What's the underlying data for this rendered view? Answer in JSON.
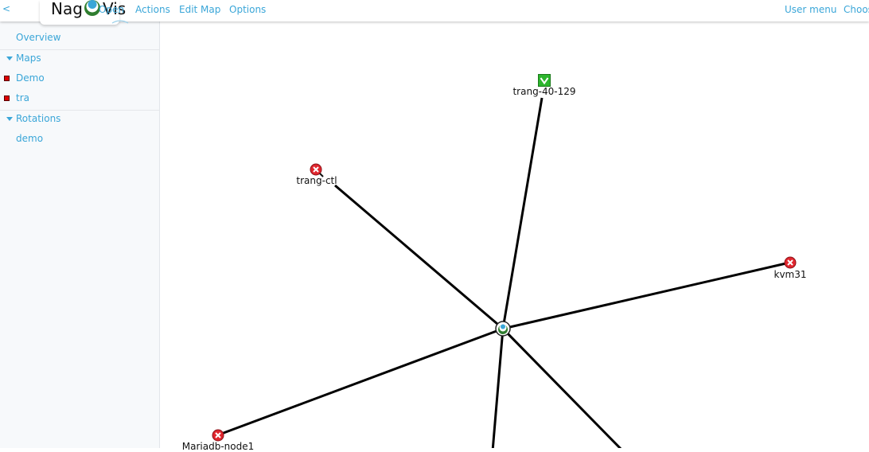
{
  "header": {
    "back": "<",
    "logo": {
      "part1": "Nag",
      "part2": "Vis"
    },
    "menu": [
      "Open",
      "Actions",
      "Edit Map",
      "Options"
    ],
    "user_menu": "User menu",
    "choose": "Choos"
  },
  "sidebar": {
    "overview": "Overview",
    "maps_header": "Maps",
    "maps": [
      "Demo",
      "tra"
    ],
    "rotations_header": "Rotations",
    "rotations": [
      "demo"
    ]
  },
  "map": {
    "hub": "hub",
    "nodes": [
      {
        "name": "trang-40-129",
        "state": "up"
      },
      {
        "name": "trang-ctl",
        "state": "down"
      },
      {
        "name": "kvm31",
        "state": "down"
      },
      {
        "name": "Mariadb-node1",
        "state": "down"
      }
    ]
  },
  "colors": {
    "link": "#3aa6d8",
    "ok": "#2db52d",
    "down": "#e0262e",
    "sidebar_bg": "#f7f9fb"
  }
}
